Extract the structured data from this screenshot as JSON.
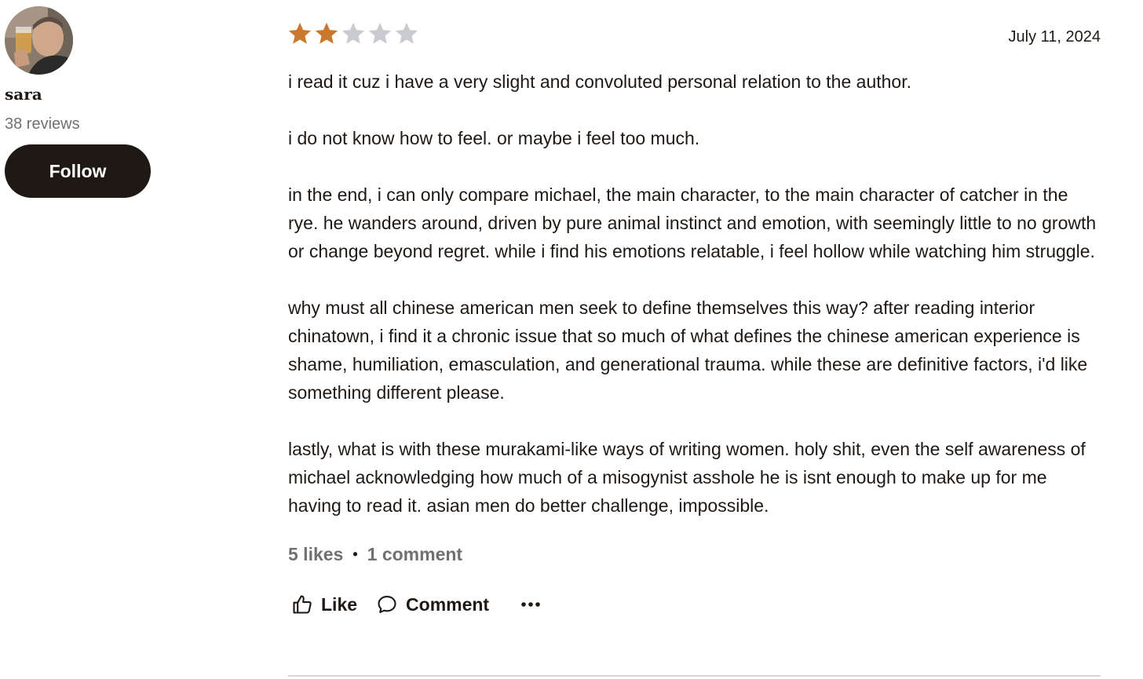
{
  "reviewer": {
    "name": "sara",
    "reviews_count": "38 reviews",
    "follow_label": "Follow",
    "avatar_icon": "user-avatar-photo"
  },
  "review": {
    "rating": 2,
    "rating_max": 5,
    "star_color_filled": "#c9782d",
    "star_color_empty": "#c9cbd1",
    "date": "July 11, 2024",
    "paragraphs": [
      "i read it cuz i have a very slight and convoluted personal relation to the author.",
      "i do not know how to feel. or maybe i feel too much.",
      "in the end, i can only compare michael, the main character, to the main character of catcher in the rye. he wanders around, driven by pure animal instinct and emotion, with seemingly little to no growth or change beyond regret. while i find his emotions relatable, i feel hollow while watching him struggle.",
      "why must all chinese american men seek to define themselves this way? after reading interior chinatown, i find it a chronic issue that so much of what defines the chinese american experience is shame, humiliation, emasculation, and generational trauma. while these are definitive factors, i'd like something different please.",
      "lastly, what is with these murakami-like ways of writing women. holy shit, even the self awareness of michael acknowledging how much of a misogynist asshole he is isnt enough to make up for me having to read it. asian men do better challenge, impossible."
    ],
    "likes": "5 likes",
    "stats_separator": "•",
    "comments": "1 comment"
  },
  "actions": {
    "like_label": "Like",
    "comment_label": "Comment",
    "like_icon": "thumbs-up-icon",
    "comment_icon": "speech-bubble-icon",
    "more_icon": "more-options-icon"
  }
}
